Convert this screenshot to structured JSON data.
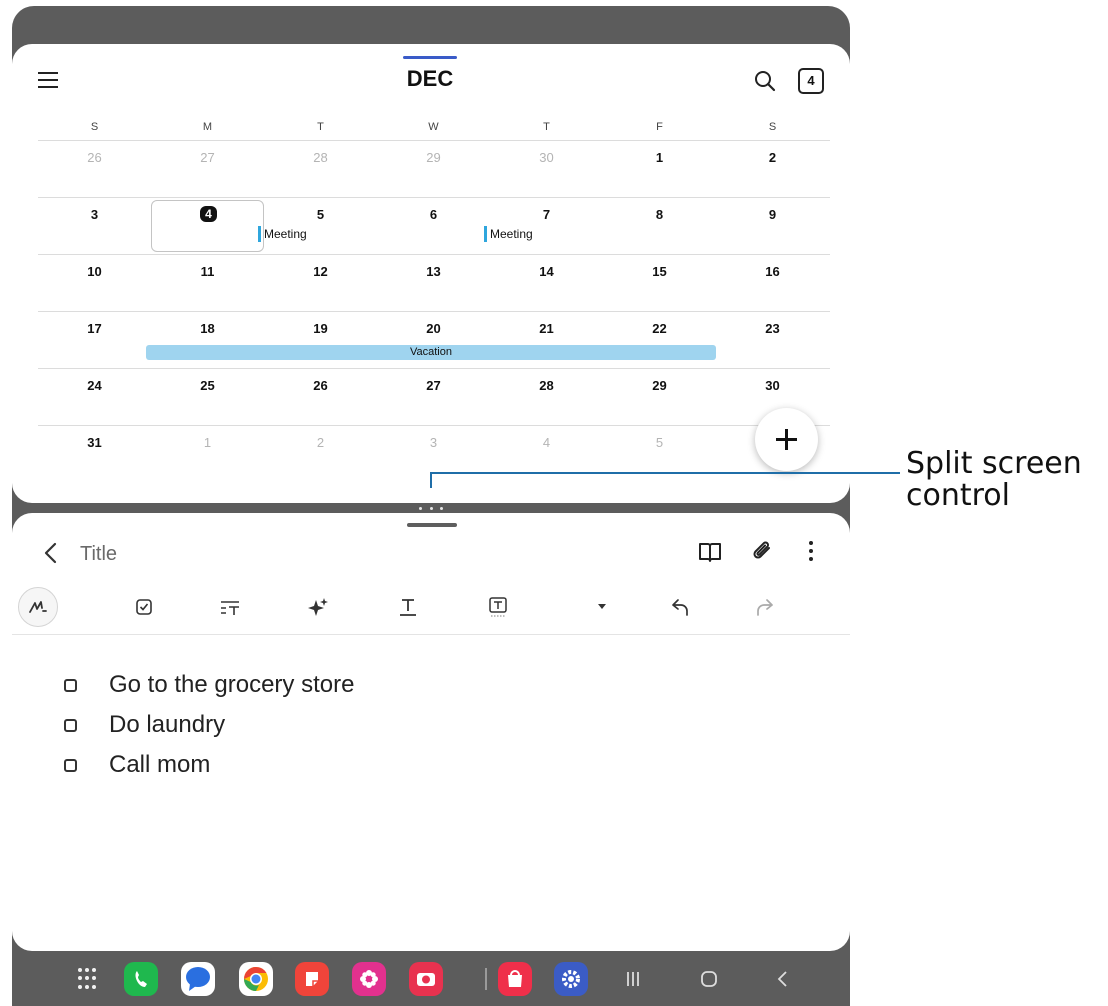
{
  "calendar": {
    "month": "DEC",
    "today_badge": "4",
    "weekdays": [
      "S",
      "M",
      "T",
      "W",
      "T",
      "F",
      "S"
    ],
    "weeks": [
      [
        {
          "n": "26",
          "muted": true
        },
        {
          "n": "27",
          "muted": true
        },
        {
          "n": "28",
          "muted": true
        },
        {
          "n": "29",
          "muted": true
        },
        {
          "n": "30",
          "muted": true
        },
        {
          "n": "1"
        },
        {
          "n": "2"
        }
      ],
      [
        {
          "n": "3"
        },
        {
          "n": "4",
          "today": true
        },
        {
          "n": "5",
          "event": "Meeting"
        },
        {
          "n": "6"
        },
        {
          "n": "7",
          "event": "Meeting"
        },
        {
          "n": "8"
        },
        {
          "n": "9"
        }
      ],
      [
        {
          "n": "10"
        },
        {
          "n": "11"
        },
        {
          "n": "12"
        },
        {
          "n": "13"
        },
        {
          "n": "14"
        },
        {
          "n": "15"
        },
        {
          "n": "16"
        }
      ],
      [
        {
          "n": "17"
        },
        {
          "n": "18"
        },
        {
          "n": "19"
        },
        {
          "n": "20"
        },
        {
          "n": "21"
        },
        {
          "n": "22"
        },
        {
          "n": "23"
        }
      ],
      [
        {
          "n": "24"
        },
        {
          "n": "25"
        },
        {
          "n": "26"
        },
        {
          "n": "27"
        },
        {
          "n": "28"
        },
        {
          "n": "29"
        },
        {
          "n": "30"
        }
      ],
      [
        {
          "n": "31"
        },
        {
          "n": "1",
          "muted": true
        },
        {
          "n": "2",
          "muted": true
        },
        {
          "n": "3",
          "muted": true
        },
        {
          "n": "4",
          "muted": true
        },
        {
          "n": "5",
          "muted": true
        },
        {
          "n": ""
        }
      ]
    ],
    "vacation_label": "Vacation",
    "event_color": "#2fa6dd",
    "vacation_color": "#9fd4ef"
  },
  "notes": {
    "title": "Title",
    "toolbar_icons": [
      "handwriting-icon",
      "checkbox-icon",
      "text-format-icon",
      "ai-sparkle-icon",
      "text-style-icon",
      "text-box-icon",
      "dropdown-icon",
      "undo-icon",
      "redo-icon"
    ],
    "items": [
      "Go to the grocery store",
      "Do laundry",
      "Call mom"
    ]
  },
  "navbar": {
    "apps": [
      {
        "name": "phone-app-icon",
        "color": "#1fb84e"
      },
      {
        "name": "messages-app-icon",
        "color": "#2a6fe0"
      },
      {
        "name": "chrome-app-icon",
        "color": "#ea4335"
      },
      {
        "name": "notes-app-icon",
        "color": "#f0443a"
      },
      {
        "name": "gallery-app-icon",
        "color": "#e2318e"
      },
      {
        "name": "camera-app-icon",
        "color": "#e8324f"
      },
      {
        "name": "store-app-icon",
        "color": "#ef2f4a"
      },
      {
        "name": "settings-app-icon",
        "color": "#3b5cc6"
      }
    ]
  },
  "callout": {
    "line1": "Split screen",
    "line2": "control"
  }
}
